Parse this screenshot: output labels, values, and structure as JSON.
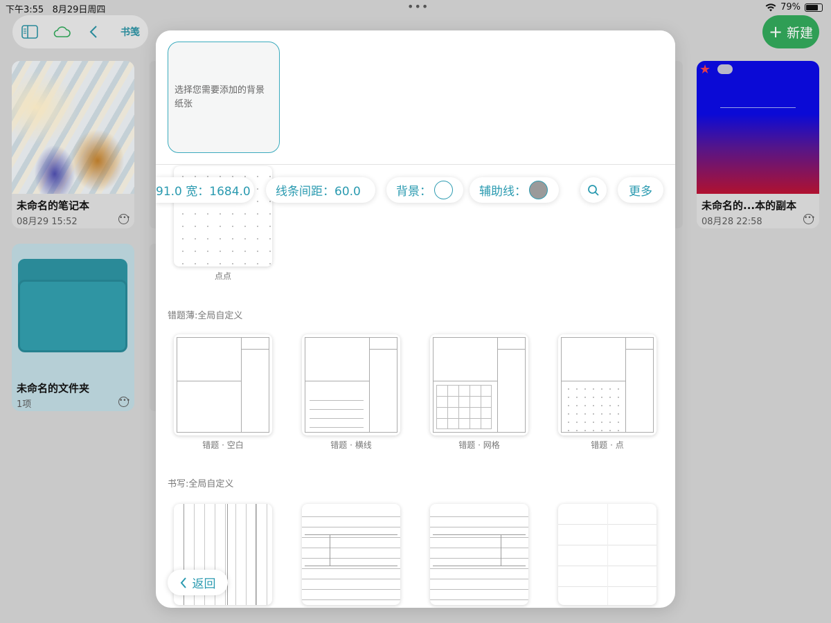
{
  "status_bar": {
    "time": "下午3:55",
    "date": "8月29日周四",
    "battery": "79%",
    "battery_level": 0.79
  },
  "toolbar": {
    "icons": [
      "sidebar-icon",
      "cloud-icon",
      "back-chevron-icon"
    ],
    "label": "书笺"
  },
  "new_button": {
    "label": "新建"
  },
  "notebooks": [
    {
      "title": "未命名的笔记本",
      "meta": "08月29 15:52",
      "cover": "marble"
    },
    {
      "title": "未命名的...本的副本",
      "meta": "08月28 22:58",
      "cover": "blue-red-gradient",
      "starred": true
    },
    {
      "title": "未命名的文件夹",
      "meta": "1项",
      "cover": "folder"
    }
  ],
  "modal": {
    "prompt": "选择您需要添加的背景纸张",
    "options": {
      "size": "91.0 宽：1684.0",
      "line_spacing": "线条间距：60.0",
      "background": "背景：",
      "guide_lines": "辅助线：",
      "more": "更多"
    },
    "colors": {
      "accent": "#2a9ab0",
      "new_button": "#2f9e55"
    },
    "dots_caption": "点点",
    "sections": [
      {
        "title": "错题薄:全局自定义",
        "papers": [
          "错题 · 空白",
          "错题 · 横线",
          "错题 · 网格",
          "错题 · 点"
        ]
      },
      {
        "title": "书写:全局自定义",
        "papers": [
          "",
          "",
          "",
          ""
        ]
      }
    ],
    "back_label": "返回"
  }
}
